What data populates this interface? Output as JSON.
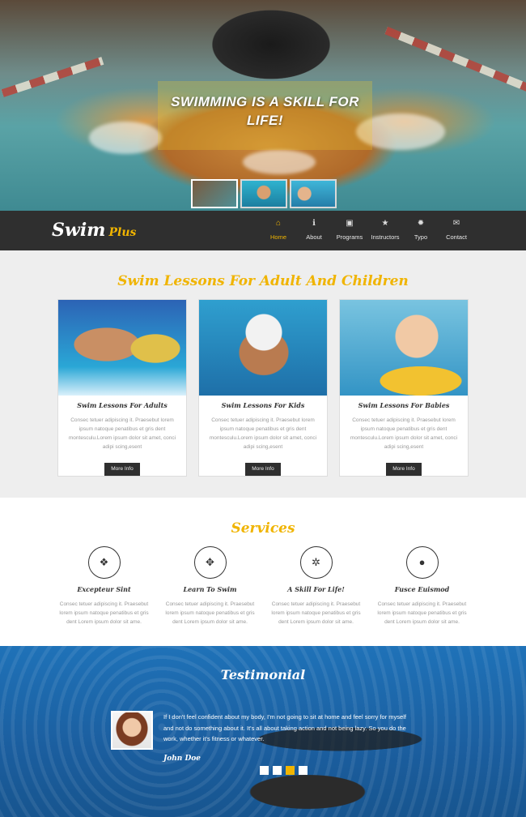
{
  "hero": {
    "title": "SWIMMING IS A SKILL FOR LIFE!",
    "thumbnails": [
      "thumb-butterfly",
      "thumb-child-cap",
      "thumb-child-float"
    ]
  },
  "nav": {
    "logo_main": "Swim",
    "logo_plus": "Plus",
    "items": [
      {
        "label": "Home",
        "icon": "home-icon",
        "glyph": "⌂",
        "active": true
      },
      {
        "label": "About",
        "icon": "info-icon",
        "glyph": "ℹ",
        "active": false
      },
      {
        "label": "Programs",
        "icon": "image-icon",
        "glyph": "▣",
        "active": false
      },
      {
        "label": "Instructors",
        "icon": "star-icon",
        "glyph": "★",
        "active": false
      },
      {
        "label": "Typo",
        "icon": "gear-icon",
        "glyph": "✹",
        "active": false
      },
      {
        "label": "Contact",
        "icon": "mail-icon",
        "glyph": "✉",
        "active": false
      }
    ],
    "accent": "#f0b400"
  },
  "lessons": {
    "title": "Swim Lessons For Adult And Children",
    "cards": [
      {
        "title": "Swim Lessons For Adults",
        "text": "Consec tetuer adipiscing it. Praesebut lorem ipsum natoque penatibus et gris dent montesculu.Lorem ipsum dolor sit amet, conci adipi scing,esent",
        "button": "More Info"
      },
      {
        "title": "Swim Lessons For Kids",
        "text": "Consec tetuer adipiscing it. Praesebut lorem ipsum natoque penatibus et gris dent montesculu.Lorem ipsum dolor sit amet, conci adipi scing,esent",
        "button": "More Info"
      },
      {
        "title": "Swim Lessons For Babies",
        "text": "Consec tetuer adipiscing it. Praesebut lorem ipsum natoque penatibus et gris dent montesculu.Lorem ipsum dolor sit amet, conci adipi scing,esent",
        "button": "More Info"
      }
    ]
  },
  "services": {
    "title": "Services",
    "items": [
      {
        "title": "Excepteur Sint",
        "icon": "gift-icon",
        "glyph": "❖",
        "text": "Consec tetuer adipiscing it. Praesebut lorem ipsum natoque penatibus et gris dent Lorem ipsum dolor sit ame."
      },
      {
        "title": "Learn To Swim",
        "icon": "move-icon",
        "glyph": "✥",
        "text": "Consec tetuer adipiscing it. Praesebut lorem ipsum natoque penatibus et gris dent Lorem ipsum dolor sit ame."
      },
      {
        "title": "A Skill For Life!",
        "icon": "cog-icon",
        "glyph": "✲",
        "text": "Consec tetuer adipiscing it. Praesebut lorem ipsum natoque penatibus et gris dent Lorem ipsum dolor sit ame."
      },
      {
        "title": "Fusce Euismod",
        "icon": "user-icon",
        "glyph": "●",
        "text": "Consec tetuer adipiscing it. Praesebut lorem ipsum natoque penatibus et gris dent Lorem ipsum dolor sit ame."
      }
    ]
  },
  "testimonial": {
    "title": "Testimonial",
    "quote": "If I don't feel confident about my body, I'm not going to sit at home and feel sorry for myself and not do something about it. It's all about taking action and not being lazy. So you do the work, whether it's fitness or whatever.",
    "author": "John Doe",
    "slides": 4,
    "active_slide": 3
  }
}
